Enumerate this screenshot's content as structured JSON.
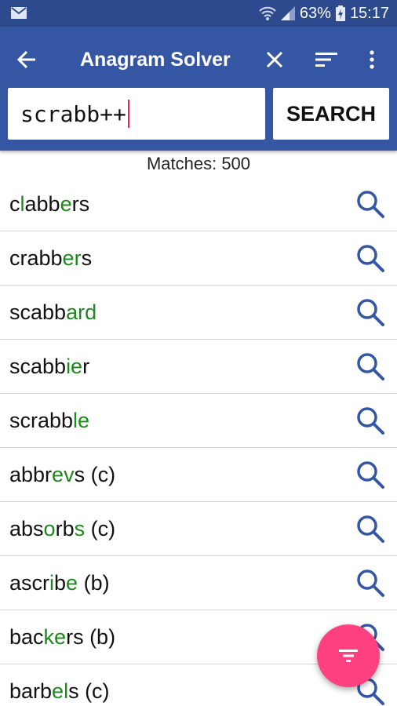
{
  "status_bar": {
    "battery": "63%",
    "time": "15:17"
  },
  "app_bar": {
    "title": "Anagram Solver"
  },
  "search": {
    "value": "scrabb++",
    "button_label": "SEARCH"
  },
  "matches_label": "Matches: 500",
  "colors": {
    "primary": "#3557a3",
    "status": "#2d4a8f",
    "highlight": "#1a8a1a",
    "fab": "#ff4081",
    "icon": "#3557a3"
  },
  "results": [
    {
      "parts": [
        {
          "t": "c",
          "h": false
        },
        {
          "t": "l",
          "h": true
        },
        {
          "t": "abb",
          "h": false
        },
        {
          "t": "e",
          "h": true
        },
        {
          "t": "rs",
          "h": false
        }
      ]
    },
    {
      "parts": [
        {
          "t": "crabb",
          "h": false
        },
        {
          "t": "er",
          "h": true
        },
        {
          "t": "s",
          "h": false
        }
      ]
    },
    {
      "parts": [
        {
          "t": "scabb",
          "h": false
        },
        {
          "t": "ard",
          "h": true
        }
      ]
    },
    {
      "parts": [
        {
          "t": "scabb",
          "h": false
        },
        {
          "t": "ie",
          "h": true
        },
        {
          "t": "r",
          "h": false
        }
      ]
    },
    {
      "parts": [
        {
          "t": "scrabb",
          "h": false
        },
        {
          "t": "le",
          "h": true
        }
      ]
    },
    {
      "parts": [
        {
          "t": "abbr",
          "h": false
        },
        {
          "t": "ev",
          "h": true
        },
        {
          "t": "s (c)",
          "h": false
        }
      ]
    },
    {
      "parts": [
        {
          "t": "abs",
          "h": false
        },
        {
          "t": "o",
          "h": true
        },
        {
          "t": "rb",
          "h": false
        },
        {
          "t": "s",
          "h": true
        },
        {
          "t": " (c)",
          "h": false
        }
      ]
    },
    {
      "parts": [
        {
          "t": "ascr",
          "h": false
        },
        {
          "t": "i",
          "h": true
        },
        {
          "t": "b",
          "h": false
        },
        {
          "t": "e",
          "h": true
        },
        {
          "t": " (b)",
          "h": false
        }
      ]
    },
    {
      "parts": [
        {
          "t": "bac",
          "h": false
        },
        {
          "t": "ke",
          "h": true
        },
        {
          "t": "rs (b)",
          "h": false
        }
      ]
    },
    {
      "parts": [
        {
          "t": "barb",
          "h": false
        },
        {
          "t": "el",
          "h": true
        },
        {
          "t": "s (c)",
          "h": false
        }
      ]
    }
  ]
}
